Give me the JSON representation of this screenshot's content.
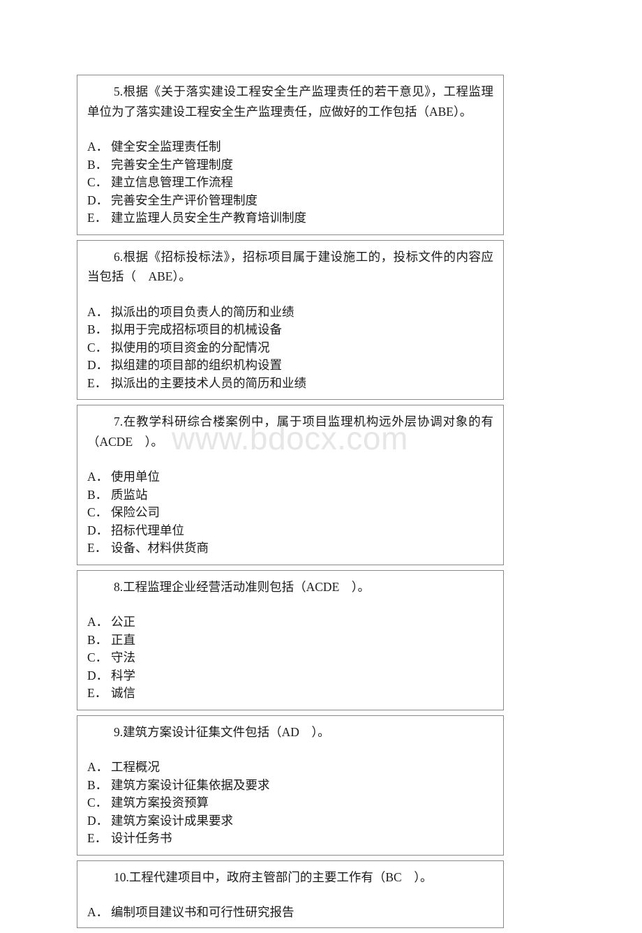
{
  "document": {
    "watermark": "www.bdocx.com",
    "page_background": "#ffffff",
    "text_color": "#1a1a1a",
    "border_color": "#8a8a8a",
    "watermark_color": "#e6e6e6"
  },
  "questions": [
    {
      "id": "q5",
      "stem": "5.根据《关于落实建设工程安全生产监理责任的若干意见》，工程监理单位为了落实建设工程安全生产监理责任，应做好的工作包括（ABE）。",
      "answer": "ABE",
      "options": [
        {
          "label": "A．",
          "text": "健全安全监理责任制"
        },
        {
          "label": "B．",
          "text": "完善安全生产管理制度"
        },
        {
          "label": "C．",
          "text": "建立信息管理工作流程"
        },
        {
          "label": "D．",
          "text": "完善安全生产评价管理制度"
        },
        {
          "label": "E．",
          "text": "建立监理人员安全生产教育培训制度"
        }
      ]
    },
    {
      "id": "q6",
      "stem": "6.根据《招标投标法》，招标项目属于建设施工的，投标文件的内容应当包括（　ABE）。",
      "answer": "ABE",
      "options": [
        {
          "label": "A．",
          "text": "拟派出的项目负责人的简历和业绩"
        },
        {
          "label": "B．",
          "text": "拟用于完成招标项目的机械设备"
        },
        {
          "label": "C．",
          "text": "拟使用的项目资金的分配情况"
        },
        {
          "label": "D．",
          "text": "拟组建的项目部的组织机构设置"
        },
        {
          "label": "E．",
          "text": "拟派出的主要技术人员的简历和业绩"
        }
      ]
    },
    {
      "id": "q7",
      "stem": "7.在教学科研综合楼案例中，属于项目监理机构远外层协调对象的有（ACDE　）。",
      "answer": "ACDE",
      "options": [
        {
          "label": "A．",
          "text": "使用单位"
        },
        {
          "label": "B．",
          "text": "质监站"
        },
        {
          "label": "C．",
          "text": "保险公司"
        },
        {
          "label": "D．",
          "text": "招标代理单位"
        },
        {
          "label": "E．",
          "text": "设备、材料供货商"
        }
      ]
    },
    {
      "id": "q8",
      "stem": "8.工程监理企业经营活动准则包括（ACDE　）。",
      "answer": "ACDE",
      "options": [
        {
          "label": "A．",
          "text": "公正"
        },
        {
          "label": "B．",
          "text": "正直"
        },
        {
          "label": "C．",
          "text": "守法"
        },
        {
          "label": "D．",
          "text": "科学"
        },
        {
          "label": "E．",
          "text": "诚信"
        }
      ]
    },
    {
      "id": "q9",
      "stem": "9.建筑方案设计征集文件包括（AD　）。",
      "answer": "AD",
      "options": [
        {
          "label": "A．",
          "text": "工程概况"
        },
        {
          "label": "B．",
          "text": "建筑方案设计征集依据及要求"
        },
        {
          "label": "C．",
          "text": "建筑方案投资预算"
        },
        {
          "label": "D．",
          "text": "建筑方案设计成果要求"
        },
        {
          "label": "E．",
          "text": "设计任务书"
        }
      ]
    },
    {
      "id": "q10",
      "stem": "10.工程代建项目中，政府主管部门的主要工作有（BC　）。",
      "answer": "BC",
      "options": [
        {
          "label": "A．",
          "text": "编制项目建议书和可行性研究报告"
        }
      ]
    }
  ]
}
